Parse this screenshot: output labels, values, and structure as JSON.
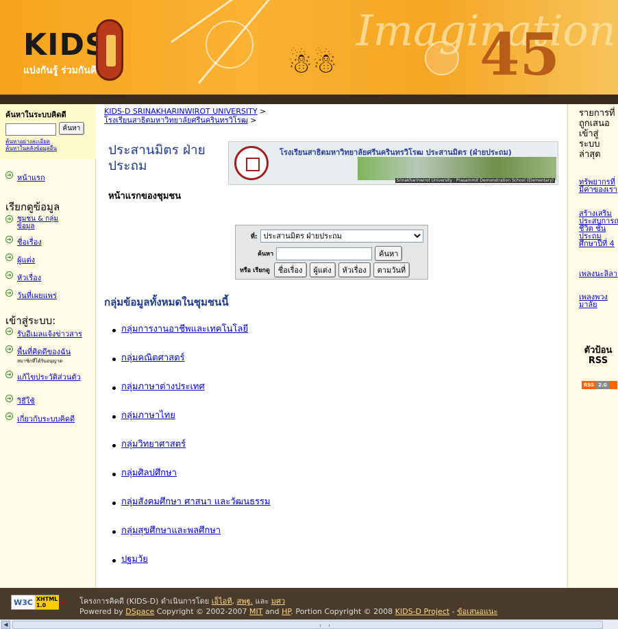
{
  "banner": {
    "logo": "KIDS",
    "tagline": "แบ่งกันรู้ ร่วมกันคิด",
    "bg_word": "Imagination",
    "bg_number": "45"
  },
  "left": {
    "search_heading": "ค้นหาในระบบคิดดี",
    "search_button": "ค้นหา",
    "search_input_value": "",
    "advanced_search": "ค้นหาอย่างละเอียด",
    "external_search": "ค้นหาในคลังข้อมูลอื่น",
    "home": "หน้าแรก",
    "browse_heading": "เรียกดูข้อมูล",
    "browse": [
      "ชุมชน & กลุ่มข้อมูล",
      "ชื่อเรื่อง",
      "ผู้แต่ง",
      "หัวเรื่อง",
      "วันที่เผยแพร่"
    ],
    "login_heading": "เข้าสู่ระบบ:",
    "login_items": [
      "รับอีเมลแจ้งข่าวสาร",
      "พื้นที่คิดดีของฉัน",
      "แก้ไขประวัติส่วนตัว"
    ],
    "login_note": "สมาชิกที่ได้รับอนุญาต",
    "help": "วิธีใช้",
    "about": "เกี่ยวกับระบบคิดดี"
  },
  "main": {
    "breadcrumb1": "KIDS-D SRINAKHARINWIROT UNIVERSITY",
    "breadcrumb2": "โรงเรียนสาธิตมหาวิทยาลัยศรีนครินทรวิโรฒ",
    "sep": ">",
    "title": "ประสานมิตร ฝ่ายประถม",
    "school_banner_title": "โรงเรียนสาธิตมหาวิทยาลัยศรีนครินทรวิโรฒ ประสานมิตร (ฝ่ายประถม)",
    "school_banner_caption": "Srinakharinwirot University : Prasarnmit Demonstration School (Elementary)",
    "subtitle": "หน้าแรกของชุมชน",
    "search": {
      "in_label": "ที่:",
      "in_value": "ประสานมิตร ฝ่ายประถม",
      "find_label": "ค้นหา",
      "find_button": "ค้นหา",
      "or_browse_label": "หรือ เรียกดู",
      "browse_buttons": [
        "ชื่อเรื่อง",
        "ผู้แต่ง",
        "หัวเรื่อง",
        "ตามวันที่"
      ]
    },
    "groups_heading": "กลุ่มข้อมูลทั้งหมดในชุมชนนี้",
    "groups": [
      "กลุ่มการงานอาชีพและเทคโนโลยี",
      "กลุ่มคณิตศาสตร์",
      "กลุ่มภาษาต่างประเทศ",
      "กลุ่มภาษาไทย",
      "กลุ่มวิทยาศาสตร์",
      "กลุ่มศิลปศึกษา",
      "กลุ่มสังคมศึกษา ศาสนา และวัฒนธรรม",
      "กลุ่มสุขศึกษาและพลศึกษา",
      "ปฐมวัย"
    ]
  },
  "right": {
    "heading": "รายการที่ถูกเสนอเข้าสู่ระบบล่าสุด",
    "links": [
      "ทรัพยากรที่มีค่าของเรา",
      "สร้างเสริมประสบการณ์ชีวิต ชั้นประถมศึกษาปีที่ 4",
      "เพลงนะลิลา",
      "เพลงพวงมาลัย"
    ],
    "rss_heading": "ตัวป้อน RSS",
    "rss_badge": "RSS",
    "rss_version": "2.0"
  },
  "footer": {
    "w3c_label": "W3C",
    "xhtml_label": "XHTML 1.0",
    "line1_prefix": "โครงการคิดดี (KIDS-D) ดำเนินการโดย",
    "line1_links": [
      "เอ็ไอที",
      "สพฐ.",
      "มศว"
    ],
    "line1_and": "และ",
    "line2": "Powered by",
    "dspace": "DSpace",
    "copyright": "Copyright © 2002-2007",
    "mit": "MIT",
    "and": "and",
    "hp": "HP",
    "portion": ". Portion Copyright © 2008",
    "kids_project": "KIDS-D Project",
    "dash": "-",
    "feedback": "ข้อเสนอแนะ"
  }
}
